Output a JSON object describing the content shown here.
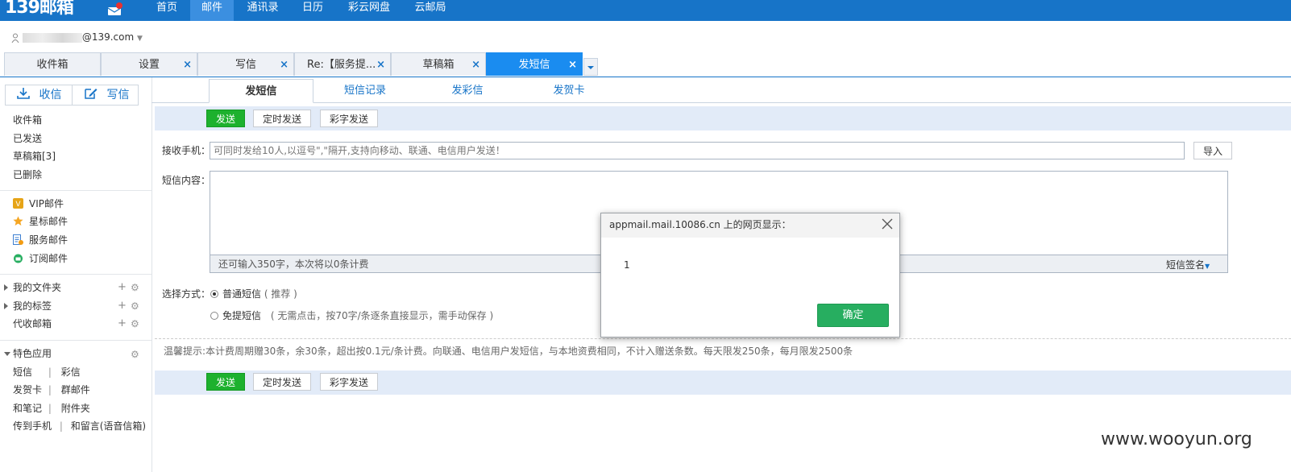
{
  "brand": {
    "logo": "139邮箱"
  },
  "nav": [
    "首页",
    "邮件",
    "通讯录",
    "日历",
    "彩云网盘",
    "云邮局"
  ],
  "account": {
    "email_suffix": "@139.com"
  },
  "tabs": [
    "收件箱",
    "设置",
    "写信",
    "Re:【服务提...",
    "草稿箱",
    "发短信"
  ],
  "tab_close": "×",
  "sidebar": {
    "receive": "收信",
    "compose": "写信",
    "folders": [
      "收件箱",
      "已发送",
      "草稿箱[3]",
      "已删除"
    ],
    "special": [
      "VIP邮件",
      "星标邮件",
      "服务邮件",
      "订阅邮件"
    ],
    "groups": [
      "我的文件夹",
      "我的标签",
      "代收邮箱"
    ],
    "apps_title": "特色应用",
    "apps": [
      [
        "短信",
        "彩信"
      ],
      [
        "发贺卡",
        "群邮件"
      ],
      [
        "和笔记",
        "附件夹"
      ],
      [
        "传到手机",
        "和留言(语音信箱)"
      ]
    ],
    "plus": "+",
    "gear": "⚙",
    "sep": "|"
  },
  "subtabs": [
    "发短信",
    "短信记录",
    "发彩信",
    "发贺卡"
  ],
  "toolbar": {
    "send": "发送",
    "timed": "定时发送",
    "art": "彩字发送"
  },
  "form": {
    "phone_label": "接收手机：",
    "phone_placeholder": "可同时发给10人,以逗号\",\"隔开,支持向移动、联通、电信用户发送！",
    "import": "导入",
    "content_label": "短信内容：",
    "remain": "还可输入350字，本次将以0条计费",
    "signature": "短信签名",
    "method_label": "选择方式：",
    "opt1": "普通短信",
    "opt1_note": "( 推荐 )",
    "opt2": "免提短信",
    "opt2_note": "( 无需点击，按70字/条逐条直接显示，需手动保存 )"
  },
  "tip": "温馨提示:本计费周期赠30条，余30条，超出按0.1元/条计费。向联通、电信用户发短信，与本地资费相同，不计入赠送条数。每天限发250条，每月限发2500条",
  "dialog": {
    "title": "appmail.mail.10086.cn 上的网页显示：",
    "message": "1",
    "ok": "确定"
  },
  "watermark": "www.wooyun.org",
  "colors": {
    "nav_bg": "#1774c8",
    "send_green": "#1db12e",
    "dialog_ok": "#27ae60"
  }
}
